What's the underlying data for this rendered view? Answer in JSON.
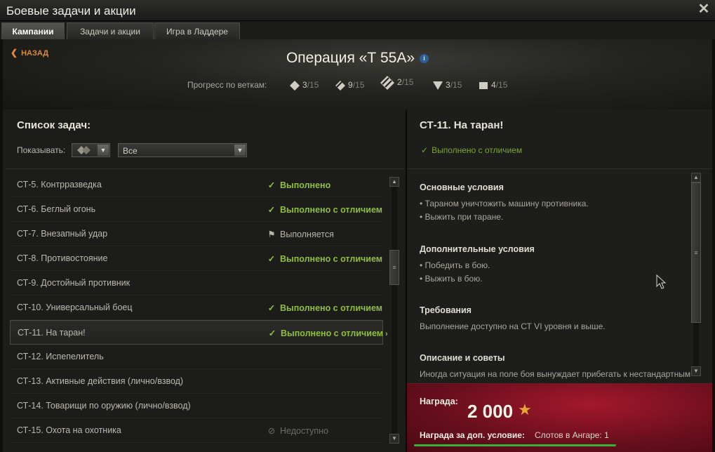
{
  "window": {
    "title": "Боевые задачи и акции"
  },
  "tabs": [
    {
      "label": "Кампании",
      "active": true
    },
    {
      "label": "Задачи и акции",
      "active": false
    },
    {
      "label": "Игра в Ладдере",
      "active": false
    }
  ],
  "header": {
    "back_label": "НАЗАД",
    "operation_title": "Операция «Т 55А»",
    "progress_label": "Прогресс по веткам:",
    "branches": [
      {
        "icon": "light-tank-icon",
        "done": "3",
        "total": "/15"
      },
      {
        "icon": "medium-tank-icon",
        "done": "9",
        "total": "/15"
      },
      {
        "icon": "heavy-tank-icon",
        "done": "2",
        "total": "/15"
      },
      {
        "icon": "td-icon",
        "done": "3",
        "total": "/15"
      },
      {
        "icon": "spg-icon",
        "done": "4",
        "total": "/15"
      }
    ]
  },
  "task_list": {
    "title": "Список задач:",
    "show_label": "Показывать:",
    "filter_value": "Все",
    "items": [
      {
        "name": "СТ-5. Контрразведка",
        "status": "Выполнено",
        "type": "done"
      },
      {
        "name": "СТ-6. Беглый огонь",
        "status": "Выполнено с отличием",
        "type": "done"
      },
      {
        "name": "СТ-7. Внезапный удар",
        "status": "Выполняется",
        "type": "progress"
      },
      {
        "name": "СТ-8. Противостояние",
        "status": "Выполнено с отличием",
        "type": "done"
      },
      {
        "name": "СТ-9. Достойный противник",
        "status": "",
        "type": "none"
      },
      {
        "name": "СТ-10. Универсальный боец",
        "status": "Выполнено с отличием",
        "type": "done"
      },
      {
        "name": "СТ-11. На таран!",
        "status": "Выполнено с отличием",
        "type": "done",
        "selected": true
      },
      {
        "name": "СТ-12. Испепелитель",
        "status": "",
        "type": "none"
      },
      {
        "name": "СТ-13. Активные действия (лично/взвод)",
        "status": "",
        "type": "none"
      },
      {
        "name": "СТ-14. Товарищи по оружию (лично/взвод)",
        "status": "",
        "type": "none"
      },
      {
        "name": "СТ-15. Охота на охотника",
        "status": "Недоступно",
        "type": "na"
      }
    ]
  },
  "mission": {
    "title": "СТ-11. На таран!",
    "status": "Выполнено с отличием",
    "main_title": "Основные условия",
    "main_lines": [
      "• Тараном уничтожить машину противника.",
      "• Выжить при таране."
    ],
    "extra_title": "Дополнительные условия",
    "extra_lines": [
      "• Победить в бою.",
      "• Выжить в бою."
    ],
    "req_title": "Требования",
    "req_text": "Выполнение доступно на СТ VI уровня и выше.",
    "tips_title": "Описание и советы",
    "tips_text": "Иногда ситуация на поле боя вынуждает прибегать к нестандартным"
  },
  "reward": {
    "label": "Награда:",
    "value": "2 000",
    "bonus_label": "Награда за доп. условие:",
    "bonus_value": "Слотов в Ангаре: 1"
  },
  "colors": {
    "done": "#8fbf3c",
    "accent": "#e08a3a",
    "reward_bg": "#8a1424",
    "bar": "#32b43a"
  }
}
